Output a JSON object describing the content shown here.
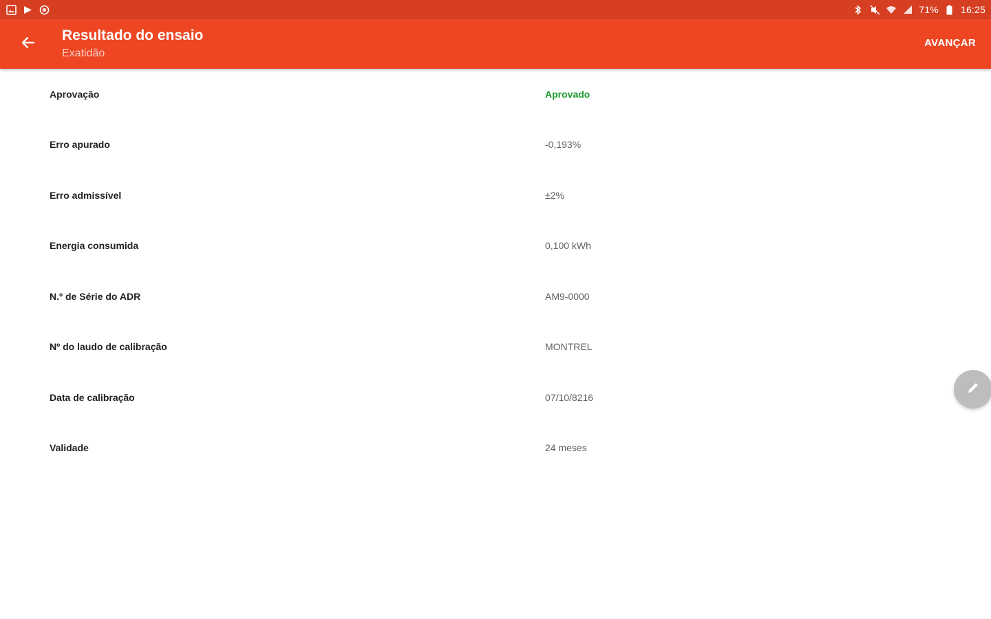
{
  "status_bar": {
    "left_icons": [
      "image-icon",
      "play-store-icon",
      "record-icon"
    ],
    "right_icons": [
      "bluetooth-icon",
      "mute-icon",
      "wifi-icon",
      "signal-icon",
      "battery-icon"
    ],
    "battery_percent": "71%",
    "time": "16:25"
  },
  "app_bar": {
    "title": "Resultado do ensaio",
    "subtitle": "Exatidão",
    "action_label": "AVANÇAR",
    "background_color": "#ee4623"
  },
  "rows": [
    {
      "label": "Aprovação",
      "value": "Aprovado"
    },
    {
      "label": "Erro apurado",
      "value": "-0,193%"
    },
    {
      "label": "Erro admissível",
      "value": "±2%"
    },
    {
      "label": "Energia consumida",
      "value": "0,100 kWh"
    },
    {
      "label": "N.º de Série do ADR",
      "value": "AM9-0000"
    },
    {
      "label": "Nº do laudo de calibração",
      "value": "MONTREL"
    },
    {
      "label": "Data de calibração",
      "value": "07/10/8216"
    },
    {
      "label": "Validade",
      "value": "24 meses"
    }
  ],
  "fab": {
    "icon": "edit-icon"
  },
  "colors": {
    "approved": "#1e9a2e",
    "status_bar": "#d63f22"
  }
}
